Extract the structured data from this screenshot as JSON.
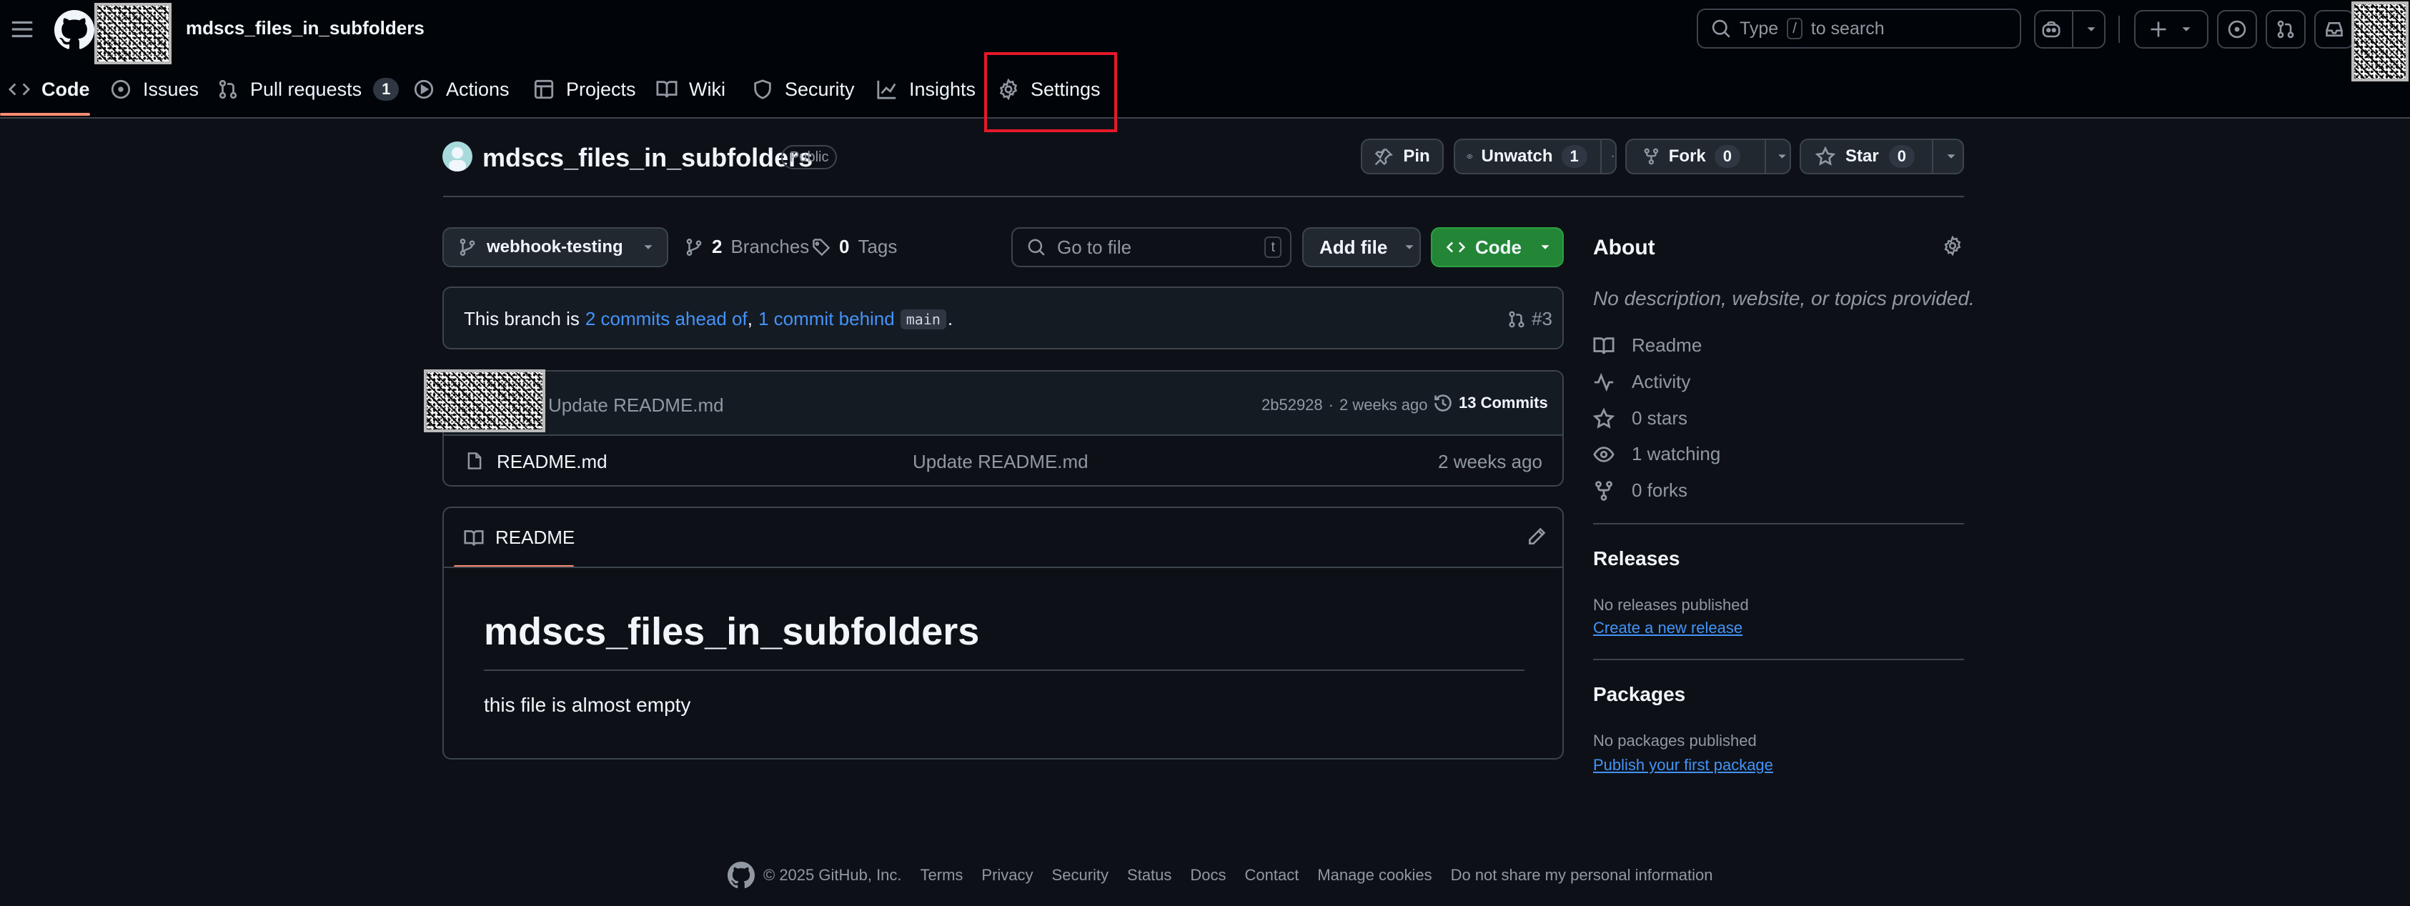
{
  "header": {
    "repo_name": "mdscs_files_in_subfolders",
    "search_placeholder_prefix": "Type",
    "search_key": "/",
    "search_placeholder_suffix": "to search"
  },
  "tabs": [
    {
      "label": "Code",
      "icon": "code-icon",
      "active": true
    },
    {
      "label": "Issues",
      "icon": "issue-icon"
    },
    {
      "label": "Pull requests",
      "icon": "pull-request-icon",
      "count": "1"
    },
    {
      "label": "Actions",
      "icon": "play-icon"
    },
    {
      "label": "Projects",
      "icon": "table-icon"
    },
    {
      "label": "Wiki",
      "icon": "book-icon"
    },
    {
      "label": "Security",
      "icon": "shield-icon"
    },
    {
      "label": "Insights",
      "icon": "graph-icon"
    },
    {
      "label": "Settings",
      "icon": "gear-icon",
      "highlighted": true
    }
  ],
  "repo": {
    "title": "mdscs_files_in_subfolders",
    "visibility": "Public",
    "pin_label": "Pin",
    "unwatch_label": "Unwatch",
    "unwatch_count": "1",
    "fork_label": "Fork",
    "fork_count": "0",
    "star_label": "Star",
    "star_count": "0"
  },
  "toolbar": {
    "branch": "webhook-testing",
    "branches_count": "2",
    "branches_label": "Branches",
    "tags_count": "0",
    "tags_label": "Tags",
    "go_to_file_placeholder": "Go to file",
    "go_to_file_key": "t",
    "add_file_label": "Add file",
    "code_label": "Code"
  },
  "branch_status": {
    "prefix": "This branch is",
    "ahead": "2 commits ahead of",
    "comma": ",",
    "behind": "1 commit behind",
    "base": "main",
    "period": ".",
    "pr_ref": "#3"
  },
  "latest_commit": {
    "message": "Update README.md",
    "hash": "2b52928",
    "separator": "·",
    "time": "2 weeks ago",
    "commits_count": "13 Commits"
  },
  "files": [
    {
      "name": "README.md",
      "message": "Update README.md",
      "time": "2 weeks ago"
    }
  ],
  "readme": {
    "tab_label": "README",
    "heading": "mdscs_files_in_subfolders",
    "body": "this file is almost empty"
  },
  "about": {
    "title": "About",
    "description": "No description, website, or topics provided.",
    "items": [
      {
        "label": "Readme",
        "icon": "book-icon"
      },
      {
        "label": "Activity",
        "icon": "pulse-icon"
      },
      {
        "label": "0 stars",
        "icon": "star-icon"
      },
      {
        "label": "1 watching",
        "icon": "eye-icon"
      },
      {
        "label": "0 forks",
        "icon": "fork-icon"
      }
    ]
  },
  "releases": {
    "title": "Releases",
    "empty": "No releases published",
    "link": "Create a new release"
  },
  "packages": {
    "title": "Packages",
    "empty": "No packages published",
    "link": "Publish your first package"
  },
  "footer": {
    "copyright": "© 2025 GitHub, Inc.",
    "links": [
      "Terms",
      "Privacy",
      "Security",
      "Status",
      "Docs",
      "Contact",
      "Manage cookies",
      "Do not share my personal information"
    ]
  },
  "colors": {
    "accent_link": "#4493f8",
    "active_tab_underline": "#fd8c73",
    "code_button": "#238636",
    "highlight_box": "#e5192a"
  }
}
